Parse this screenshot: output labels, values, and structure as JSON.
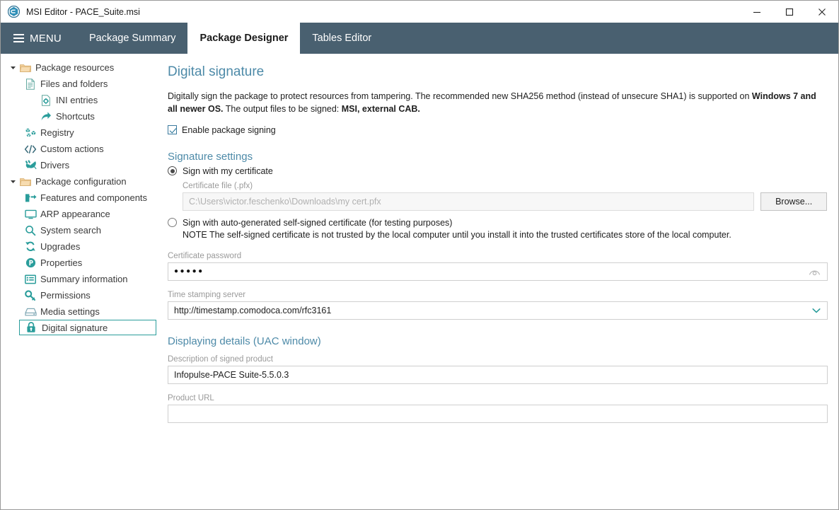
{
  "window": {
    "title": "MSI Editor - PACE_Suite.msi",
    "app_icon": "app-logo-icon",
    "controls": {
      "minimize": "—",
      "maximize": "☐",
      "close": "✕"
    }
  },
  "tabbar": {
    "menu_label": "MENU",
    "tabs": [
      {
        "label": "Package Summary",
        "active": false
      },
      {
        "label": "Package Designer",
        "active": true
      },
      {
        "label": "Tables Editor",
        "active": false
      }
    ]
  },
  "sidebar": {
    "items": [
      {
        "label": "Package resources",
        "level": 0,
        "icon": "folder-icon",
        "caret": "▾",
        "selected": false
      },
      {
        "label": "Files and folders",
        "level": 1,
        "icon": "document-icon",
        "caret": "",
        "selected": false
      },
      {
        "label": "INI entries",
        "level": 2,
        "icon": "ini-file-icon",
        "caret": "",
        "selected": false
      },
      {
        "label": "Shortcuts",
        "level": 2,
        "icon": "shortcut-arrow-icon",
        "caret": "",
        "selected": false
      },
      {
        "label": "Registry",
        "level": 1,
        "icon": "registry-blocks-icon",
        "caret": "",
        "selected": false
      },
      {
        "label": "Custom actions",
        "level": 1,
        "icon": "code-brackets-icon",
        "caret": "",
        "selected": false
      },
      {
        "label": "Drivers",
        "level": 1,
        "icon": "plug-icon",
        "caret": "",
        "selected": false
      },
      {
        "label": "Package configuration",
        "level": 0,
        "icon": "folder-icon",
        "caret": "▾",
        "selected": false
      },
      {
        "label": "Features and components",
        "level": 1,
        "icon": "puzzle-piece-icon",
        "caret": "",
        "selected": false
      },
      {
        "label": "ARP appearance",
        "level": 1,
        "icon": "monitor-icon",
        "caret": "",
        "selected": false
      },
      {
        "label": "System search",
        "level": 1,
        "icon": "magnifier-icon",
        "caret": "",
        "selected": false
      },
      {
        "label": "Upgrades",
        "level": 1,
        "icon": "refresh-circle-icon",
        "caret": "",
        "selected": false
      },
      {
        "label": "Properties",
        "level": 1,
        "icon": "p-circle-icon",
        "caret": "",
        "selected": false
      },
      {
        "label": "Summary information",
        "level": 1,
        "icon": "list-panel-icon",
        "caret": "",
        "selected": false
      },
      {
        "label": "Permissions",
        "level": 1,
        "icon": "key-icon",
        "caret": "",
        "selected": false
      },
      {
        "label": "Media settings",
        "level": 1,
        "icon": "disk-drive-icon",
        "caret": "",
        "selected": false
      },
      {
        "label": "Digital signature",
        "level": 1,
        "icon": "lock-icon",
        "caret": "",
        "selected": true
      }
    ]
  },
  "page": {
    "title": "Digital signature",
    "description_part1": "Digitally sign the package to protect resources from tampering. The recommended new SHA256 method (instead of unsecure SHA1) is supported on ",
    "description_bold1": "Windows 7 and all newer OS.",
    "description_part2": " The output files to be signed: ",
    "description_bold2": "MSI, external CAB.",
    "enable_signing_label": "Enable package signing",
    "enable_signing_checked": true
  },
  "signature_settings": {
    "heading": "Signature settings",
    "option_my_certificate": "Sign with my certificate",
    "option_my_certificate_selected": true,
    "certificate_file_label": "Certificate file (.pfx)",
    "certificate_file_value": "C:\\Users\\victor.feschenko\\Downloads\\my cert.pfx",
    "browse_label": "Browse...",
    "option_self_signed": "Sign with auto-generated self-signed certificate (for testing purposes)",
    "option_self_signed_selected": false,
    "self_signed_note": "NOTE The self-signed certificate is not trusted by the local computer until you install it into the trusted certificates store of the local computer.",
    "password_label": "Certificate password",
    "password_value": "●●●●●",
    "password_reveal_icon": "eye-icon",
    "timestamp_label": "Time stamping server",
    "timestamp_value": "http://timestamp.comodoca.com/rfc3161",
    "timestamp_dropdown_icon": "chevron-down-icon"
  },
  "display_details": {
    "heading": "Displaying details (UAC window)",
    "description_label": "Description of signed product",
    "description_value": "Infopulse-PACE Suite-5.5.0.3",
    "product_url_label": "Product URL",
    "product_url_value": ""
  },
  "colors": {
    "ribbon": "#496070",
    "accent_teal": "#2a9d9b",
    "heading_blue": "#4d8aa8",
    "folder_tan": "#e8c489"
  }
}
